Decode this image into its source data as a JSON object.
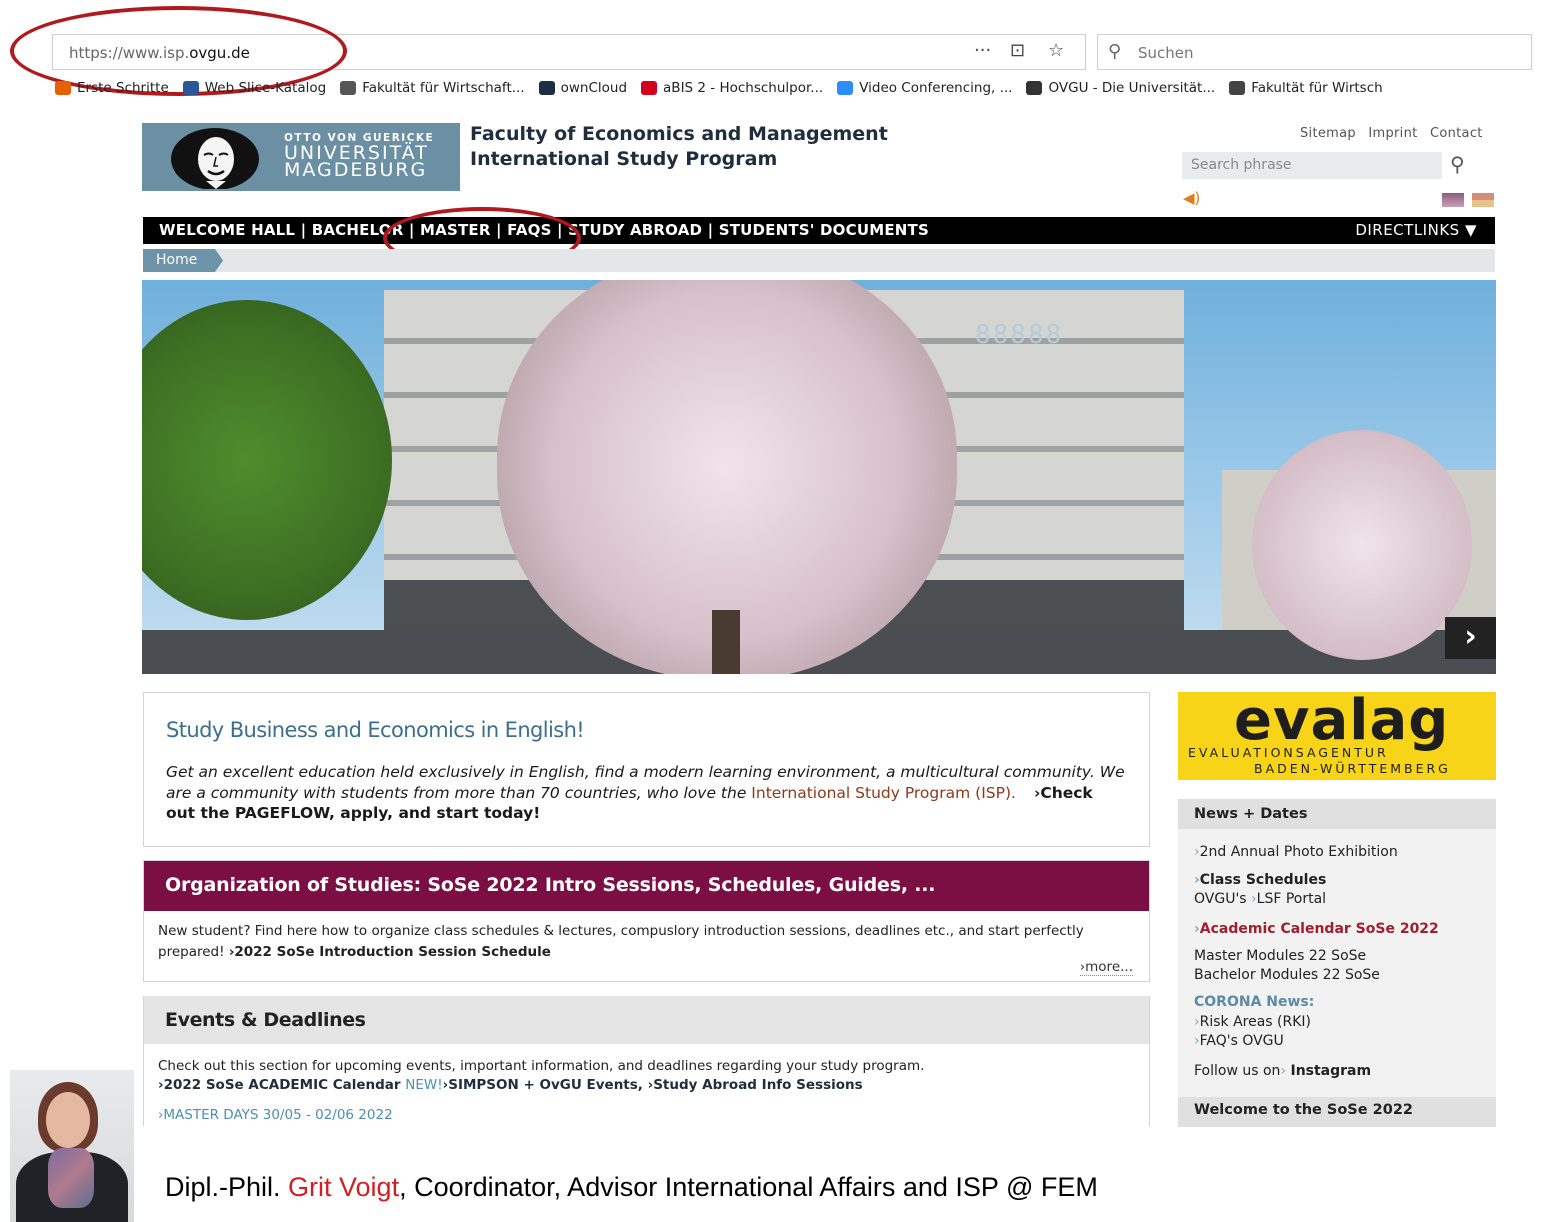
{
  "browser": {
    "url_prefix": "https://www.isp.",
    "url_domain": "ovgu.de",
    "toolbar_icons": [
      "more-icon",
      "pocket-icon",
      "star-icon"
    ],
    "search_placeholder": "Suchen",
    "bookmarks": [
      {
        "label": "Erste Schritte",
        "icon": "firefox-icon",
        "color": "#e66000"
      },
      {
        "label": "Web Slice-Katalog",
        "icon": "webslice-icon",
        "color": "#2b5797"
      },
      {
        "label": "Fakultät für Wirtschaft...",
        "icon": "globe-icon",
        "color": "#555555"
      },
      {
        "label": "ownCloud",
        "icon": "owncloud-icon",
        "color": "#1d2d44"
      },
      {
        "label": "aBIS 2 - Hochschulpor...",
        "icon": "abis-icon",
        "color": "#d1001f"
      },
      {
        "label": "Video Conferencing, ...",
        "icon": "zoom-icon",
        "color": "#2d8cff"
      },
      {
        "label": "OVGU - Die Universität...",
        "icon": "ovgu-icon",
        "color": "#333333"
      },
      {
        "label": "Fakultät für Wirtsch",
        "icon": "faculty-icon",
        "color": "#444444"
      }
    ]
  },
  "header": {
    "logo_small": "OTTO VON GUERICKE",
    "logo_line1": "UNIVERSITÄT",
    "logo_line2": "MAGDEBURG",
    "faculty_line1": "Faculty of Economics and Management",
    "faculty_line2": "International Study Program",
    "toplinks": [
      "Sitemap",
      "Imprint",
      "Contact"
    ],
    "search_placeholder": "Search phrase"
  },
  "nav": {
    "items": "WELCOME HALL | BACHELOR | MASTER | FAQS | STUDY ABROAD | STUDENTS' DOCUMENTS",
    "directlinks": "DIRECTLINKS ▼"
  },
  "breadcrumb": {
    "home": "Home"
  },
  "hero": {
    "sign": "88888",
    "next": "›"
  },
  "intro": {
    "title": "Study Business and Economics in English!",
    "text": "Get an excellent education held exclusively in English, find a modern learning environment, a multicultural community. We are a community with students from more than 70 countries, who love the ",
    "isp": "International Study Program (ISP).",
    "cta": "›Check out the PAGEFLOW, apply, and start today!"
  },
  "organization": {
    "title": "Organization of Studies: SoSe 2022 Intro Sessions, Schedules, Guides, ...",
    "text": "New student? Find here how to organize class schedules & lectures, compuslory introduction sessions, deadlines etc., and start perfectly prepared! ",
    "link": "›2022 SoSe Introduction Session Schedule",
    "more": "›more..."
  },
  "events": {
    "title": "Events & Deadlines",
    "text": "Check out this section for upcoming events, important information, and deadlines regarding your study program.",
    "link1": "›2022 SoSe ACADEMIC Calendar",
    "new_badge": "NEW!",
    "link2": "›SIMPSON + OvGU Events,",
    "link3": "›Study Abroad Info Sessions",
    "master_days": "›MASTER DAYS 30/05 - 02/06 2022"
  },
  "sidebar": {
    "evalag_word": "evalag",
    "evalag_sub1": "EVALUATIONSAGENTUR",
    "evalag_sub2": "BADEN-WÜRTTEMBERG",
    "news_title": "News + Dates",
    "items": {
      "photo": "2nd Annual Photo Exhibition",
      "schedules": "Class Schedules",
      "ovgus": "OVGU's",
      "lsf": "LSF Portal",
      "calendar": "Academic Calendar SoSe 2022",
      "master_modules": "Master Modules 22 SoSe",
      "bachelor_modules": "Bachelor Modules 22 SoSe",
      "corona": "CORONA News:",
      "risk": "Risk Areas (RKI)",
      "faq": "FAQ's OVGU",
      "follow": "Follow us on",
      "instagram": "Instagram"
    },
    "welcome_title": "Welcome to the SoSe 2022"
  },
  "caption": {
    "prefix": "Dipl.-Phil. ",
    "name": "Grit Voigt",
    "suffix": ", Coordinator, Advisor International Affairs and ISP @ FEM"
  },
  "colors": {
    "annotation_red": "#b0191e",
    "nav_black": "#000000",
    "org_maroon": "#7b0f43",
    "evalag_yellow": "#f7d417",
    "link_blue": "#4e8fb0",
    "caption_name_red": "#d21f25"
  }
}
